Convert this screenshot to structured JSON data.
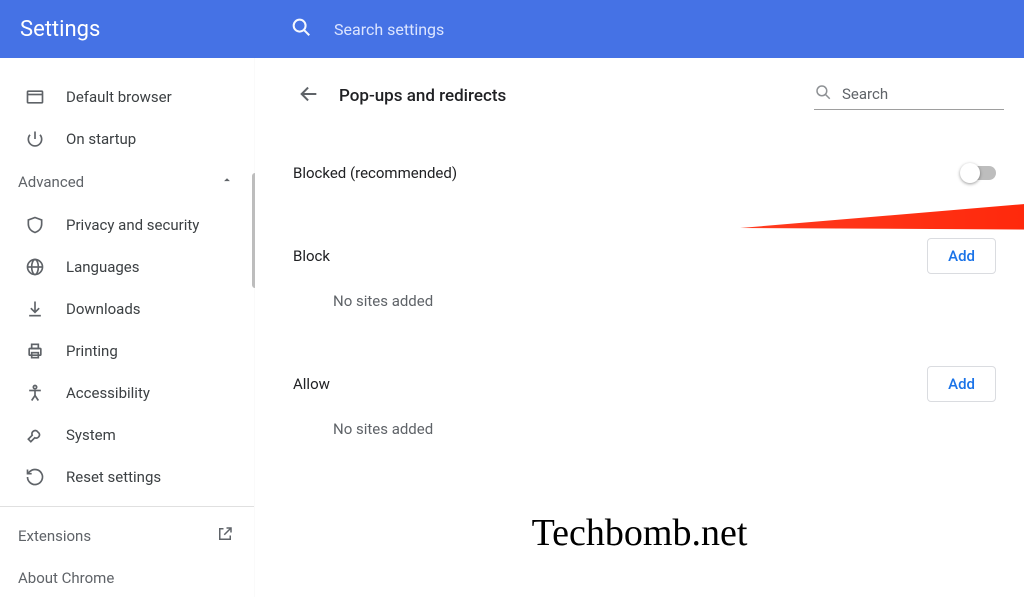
{
  "header": {
    "title": "Settings",
    "search_placeholder": "Search settings"
  },
  "sidebar": {
    "items_top": [
      {
        "label": "Default browser"
      },
      {
        "label": "On startup"
      }
    ],
    "advanced_label": "Advanced",
    "items_advanced": [
      {
        "label": "Privacy and security"
      },
      {
        "label": "Languages"
      },
      {
        "label": "Downloads"
      },
      {
        "label": "Printing"
      },
      {
        "label": "Accessibility"
      },
      {
        "label": "System"
      },
      {
        "label": "Reset settings"
      }
    ],
    "extensions_label": "Extensions",
    "about_label": "About Chrome"
  },
  "main": {
    "title": "Pop-ups and redirects",
    "search_placeholder": "Search",
    "blocked_label": "Blocked (recommended)",
    "block_section": "Block",
    "allow_section": "Allow",
    "no_sites": "No sites added",
    "add_label": "Add"
  },
  "watermark": "Techbomb.net"
}
